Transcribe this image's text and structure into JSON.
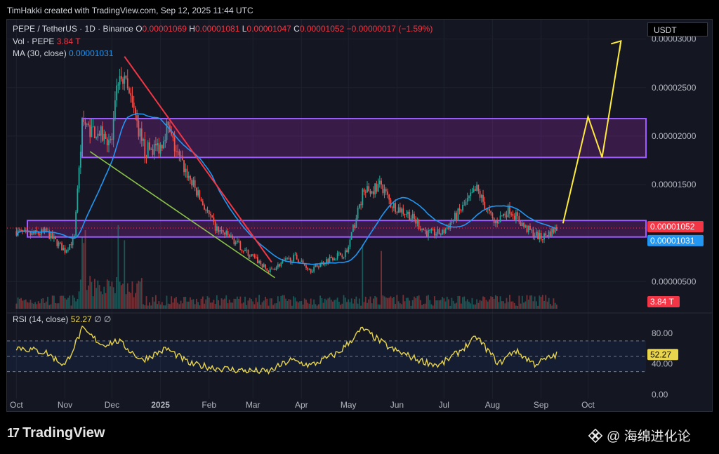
{
  "credit": "TimHakki created with TradingView.com, Sep 12, 2025 11:44 UTC",
  "legend": {
    "symbol": "PEPE / TetherUS · 1D · Binance",
    "o_label": "O",
    "o_val": "0.00001069",
    "h_label": "H",
    "h_val": "0.00001081",
    "l_label": "L",
    "l_val": "0.00001047",
    "c_label": "C",
    "c_val": "0.00001052",
    "change": "−0.00000017 (−1.59%)",
    "vol_label": "Vol · PEPE",
    "vol_val": "3.84 T",
    "ma_label": "MA (30, close)",
    "ma_val": "0.00001031"
  },
  "currency": "USDT",
  "rsi_legend": {
    "label": "RSI (14, close)",
    "value": "52.27",
    "icons": "∅ ∅"
  },
  "badges": {
    "last_price": "0.00001052",
    "ma_value": "0.00001031",
    "volume": "3.84 T",
    "rsi": "52.27"
  },
  "branding": {
    "logo_text": "TradingView",
    "watermark": "@ 海绵进化论"
  },
  "colors": {
    "up": "#26a69a",
    "down": "#ef5350",
    "ma": "#2196f3",
    "rsi": "#e8d44d",
    "zone": "#9c27b0",
    "projection": "#ffeb3b",
    "downtrend": "#f23645",
    "support": "#8bc34a"
  },
  "chart_data": {
    "type": "candlestick",
    "symbol": "PEPE / TetherUS",
    "interval": "1D",
    "exchange": "Binance",
    "price_axis": {
      "ticks": [
        "0.00003000",
        "0.00002500",
        "0.00002000",
        "0.00001500",
        "0.00000500"
      ],
      "ylim": [
        2.2e-06,
        3.2e-05
      ]
    },
    "time_axis": {
      "ticks": [
        "Oct",
        "Nov",
        "Dec",
        "2025",
        "Feb",
        "Mar",
        "Apr",
        "May",
        "Jun",
        "Jul",
        "Aug",
        "Sep",
        "Oct"
      ]
    },
    "price_path": [
      [
        "2024-10-01",
        1.02e-05
      ],
      [
        "2024-10-08",
        9.8e-06
      ],
      [
        "2024-10-20",
        1.01e-05
      ],
      [
        "2024-11-01",
        8.2e-06
      ],
      [
        "2024-11-07",
        9.5e-06
      ],
      [
        "2024-11-12",
        2.1e-05
      ],
      [
        "2024-11-20",
        2.05e-05
      ],
      [
        "2024-12-01",
        1.95e-05
      ],
      [
        "2024-12-05",
        2.6e-05
      ],
      [
        "2024-12-09",
        2.55e-05
      ],
      [
        "2024-12-15",
        2.25e-05
      ],
      [
        "2024-12-22",
        1.85e-05
      ],
      [
        "2025-01-01",
        1.9e-05
      ],
      [
        "2025-01-05",
        2.1e-05
      ],
      [
        "2025-01-12",
        1.8e-05
      ],
      [
        "2025-01-20",
        1.55e-05
      ],
      [
        "2025-01-28",
        1.3e-05
      ],
      [
        "2025-02-05",
        1.05e-05
      ],
      [
        "2025-02-15",
        9.5e-06
      ],
      [
        "2025-02-25",
        8e-06
      ],
      [
        "2025-03-05",
        7e-06
      ],
      [
        "2025-03-11",
        6e-06
      ],
      [
        "2025-03-20",
        7e-06
      ],
      [
        "2025-03-28",
        7.5e-06
      ],
      [
        "2025-04-07",
        6.2e-06
      ],
      [
        "2025-04-20",
        7.5e-06
      ],
      [
        "2025-04-30",
        8e-06
      ],
      [
        "2025-05-10",
        1.4e-05
      ],
      [
        "2025-05-22",
        1.5e-05
      ],
      [
        "2025-05-28",
        1.3e-05
      ],
      [
        "2025-06-08",
        1.2e-05
      ],
      [
        "2025-06-20",
        1e-05
      ],
      [
        "2025-06-30",
        1e-05
      ],
      [
        "2025-07-10",
        1.2e-05
      ],
      [
        "2025-07-22",
        1.45e-05
      ],
      [
        "2025-08-02",
        1.1e-05
      ],
      [
        "2025-08-12",
        1.25e-05
      ],
      [
        "2025-08-22",
        1.05e-05
      ],
      [
        "2025-09-01",
        9.5e-06
      ],
      [
        "2025-09-11",
        1.05e-05
      ]
    ],
    "last_price": 1.052e-05,
    "ma30_last": 1.031e-05,
    "volume_last": "3.84 T",
    "annotations": {
      "upper_zone": [
        1.78e-05,
        2.18e-05
      ],
      "lower_zone": [
        9.6e-06,
        1.13e-05
      ],
      "downtrend_line": [
        [
          "2024-12-09",
          2.82e-05
        ],
        [
          "2025-03-13",
          7e-06
        ]
      ],
      "support_line": [
        [
          "2024-11-17",
          1.84e-05
        ],
        [
          "2025-03-15",
          5.4e-06
        ]
      ],
      "projection": [
        [
          "2025-09-15",
          1.1e-05
        ],
        [
          "2025-10-01",
          2.2e-05
        ],
        [
          "2025-10-10",
          1.78e-05
        ],
        [
          "2025-10-22",
          2.98e-05
        ]
      ]
    },
    "rsi": {
      "axis_ticks": [
        "80.00",
        "40.00",
        "0.00"
      ],
      "ylim": [
        -5,
        100
      ],
      "bands": [
        30,
        70
      ],
      "last": 52.27,
      "path": [
        [
          "2024-10-01",
          62
        ],
        [
          "2024-10-20",
          55
        ],
        [
          "2024-11-01",
          38
        ],
        [
          "2024-11-12",
          85
        ],
        [
          "2024-11-25",
          65
        ],
        [
          "2024-12-05",
          70
        ],
        [
          "2024-12-20",
          45
        ],
        [
          "2025-01-05",
          60
        ],
        [
          "2025-01-20",
          40
        ],
        [
          "2025-02-05",
          35
        ],
        [
          "2025-02-20",
          32
        ],
        [
          "2025-03-11",
          30
        ],
        [
          "2025-03-25",
          45
        ],
        [
          "2025-04-07",
          38
        ],
        [
          "2025-04-25",
          55
        ],
        [
          "2025-05-10",
          86
        ],
        [
          "2025-05-28",
          60
        ],
        [
          "2025-06-15",
          45
        ],
        [
          "2025-06-28",
          38
        ],
        [
          "2025-07-10",
          55
        ],
        [
          "2025-07-22",
          75
        ],
        [
          "2025-08-05",
          40
        ],
        [
          "2025-08-15",
          58
        ],
        [
          "2025-08-28",
          40
        ],
        [
          "2025-09-11",
          52
        ]
      ]
    }
  }
}
